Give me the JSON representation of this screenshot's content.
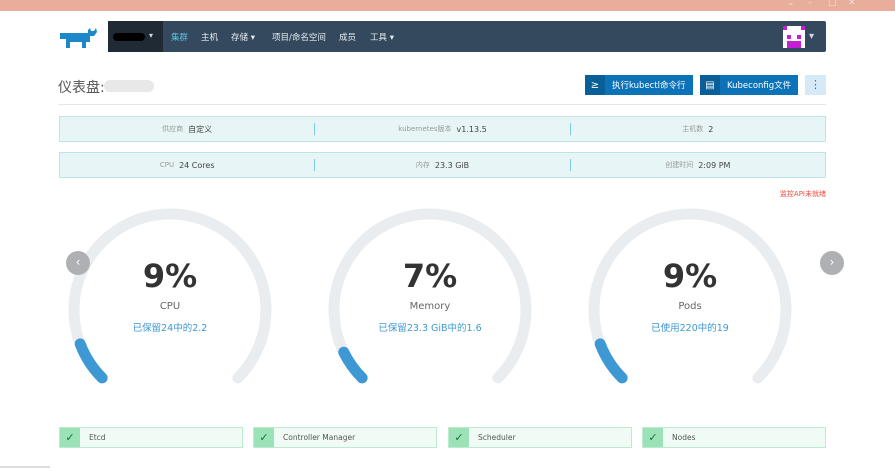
{
  "nav": {
    "items": [
      {
        "label": "集群",
        "active": true
      },
      {
        "label": "主机"
      },
      {
        "label": "存储",
        "dropdown": true
      },
      {
        "label": "项目/命名空间"
      },
      {
        "label": "成员"
      },
      {
        "label": "工具",
        "dropdown": true
      }
    ]
  },
  "page": {
    "title": "仪表盘:"
  },
  "actions": {
    "kubectl": "执行kubectl命令行",
    "kubeconfig": "Kubeconfig文件",
    "more": "⋮"
  },
  "info_row1": [
    {
      "k": "供应商",
      "v": "自定义"
    },
    {
      "k": "kubernetes版本",
      "v": "v1.13.5"
    },
    {
      "k": "主机数",
      "v": "2"
    }
  ],
  "info_row2": [
    {
      "k": "CPU",
      "v": "24 Cores"
    },
    {
      "k": "内存",
      "v": "23.3 GiB"
    },
    {
      "k": "创建时间",
      "v": "2:09 PM"
    }
  ],
  "warning": "监控API未就绪",
  "gauges": [
    {
      "value": "9%",
      "percent": 9,
      "name": "CPU",
      "sub": "已保留24中的2.2"
    },
    {
      "value": "7%",
      "percent": 7,
      "name": "Memory",
      "sub": "已保留23.3 GiB中的1.6"
    },
    {
      "value": "9%",
      "percent": 9,
      "name": "Pods",
      "sub": "已使用220中的19"
    }
  ],
  "components": [
    {
      "name": "Etcd"
    },
    {
      "name": "Controller Manager"
    },
    {
      "name": "Scheduler"
    },
    {
      "name": "Nodes"
    }
  ],
  "colors": {
    "accent": "#3d98d3",
    "nav": "#34495e",
    "ok": "#9be3b7",
    "warn": "#f04a3a"
  }
}
